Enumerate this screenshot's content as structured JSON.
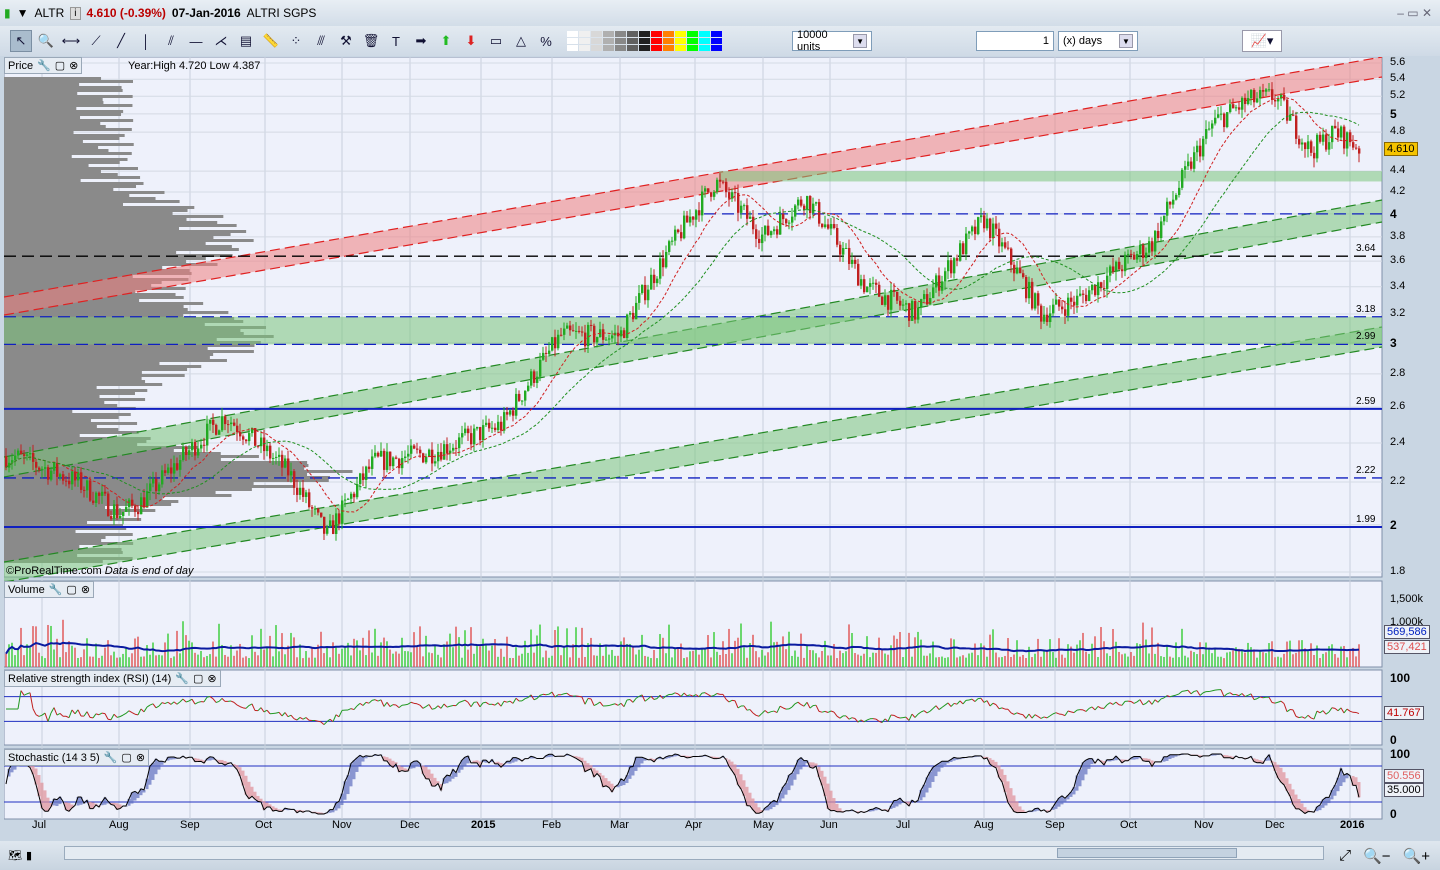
{
  "title": {
    "symbol": "ALTR",
    "price": "4.610 (-0.39%)",
    "date": "07-Jan-2016",
    "name": "ALTRI SGPS"
  },
  "toolbar": {
    "units": "10000 units",
    "period_value": "1",
    "period_unit": "(x) days",
    "icons": [
      "pointer-icon",
      "zoom-icon",
      "horizontal-line-icon",
      "segment-icon",
      "line-icon",
      "vertical-line-icon",
      "channel-icon",
      "hline-icon",
      "fan-icon",
      "indicator-icon",
      "ruler-icon",
      "points-icon",
      "parallel-icon",
      "tools-icon",
      "trash-icon",
      "text-icon",
      "arrow-right-icon",
      "arrow-up-icon",
      "arrow-down-icon",
      "rectangle-icon",
      "triangle-icon",
      "percent-icon"
    ],
    "colors": [
      "#ffffff",
      "#f0f0f0",
      "#d8d8d8",
      "#b0b0b0",
      "#888888",
      "#606060",
      "#202020",
      "#ff0000",
      "#ff8000",
      "#ffff00",
      "#00ff00",
      "#00ffff",
      "#0000ff"
    ]
  },
  "panels": {
    "price": {
      "label": "Price",
      "info": "Year:High 4.720 Low 4.387",
      "footer": "©ProRealTime.com",
      "footer_note": "Data is end of day",
      "last": "4.610",
      "yticks": [
        "5.6",
        "5.4",
        "5.2",
        "5",
        "4.8",
        "4.4",
        "4.2",
        "4",
        "3.8",
        "3.6",
        "3.4",
        "3.2",
        "3",
        "2.8",
        "2.6",
        "2.4",
        "2.2",
        "2",
        "1.8"
      ],
      "levels": [
        "3.64",
        "3.18",
        "2.99",
        "2.59",
        "2.22",
        "1.99"
      ]
    },
    "volume": {
      "label": "Volume",
      "yticks": [
        "1,500k",
        "1,000k"
      ],
      "ma": "569,586",
      "last": "537,421"
    },
    "rsi": {
      "label": "Relative strength index (RSI) (14)",
      "yticks": [
        "100",
        "0"
      ],
      "last": "41.767"
    },
    "stoch": {
      "label": "Stochastic (14 3 5)",
      "yticks": [
        "100",
        "0"
      ],
      "k": "50.556",
      "d": "35.000"
    }
  },
  "xaxis": [
    "Jul",
    "Aug",
    "Sep",
    "Oct",
    "Nov",
    "Dec",
    "2015",
    "Feb",
    "Mar",
    "Apr",
    "May",
    "Jun",
    "Jul",
    "Aug",
    "Sep",
    "Oct",
    "Nov",
    "Dec",
    "2016"
  ],
  "chart_data": {
    "type": "candlestick",
    "title": "ALTR",
    "scale": "log",
    "ylim": [
      1.8,
      5.6
    ],
    "x": [
      "2014-06-20",
      "2014-07-15",
      "2014-08-01",
      "2014-08-10",
      "2014-09-15",
      "2014-10-10",
      "2014-10-25",
      "2014-11-15",
      "2014-12-10",
      "2015-01-10",
      "2015-02-05",
      "2015-03-01",
      "2015-04-10",
      "2015-05-01",
      "2015-05-20",
      "2015-06-15",
      "2015-07-05",
      "2015-08-01",
      "2015-08-25",
      "2015-09-10",
      "2015-10-10",
      "2015-11-05",
      "2015-11-20",
      "2015-12-01",
      "2015-12-15",
      "2015-12-25",
      "2016-01-07"
    ],
    "close": [
      2.33,
      2.2,
      2.05,
      2.1,
      2.55,
      2.25,
      1.95,
      2.3,
      2.35,
      2.5,
      3.05,
      3.05,
      4.3,
      3.8,
      4.15,
      3.4,
      3.2,
      3.95,
      3.2,
      3.3,
      3.75,
      4.9,
      5.15,
      5.2,
      4.6,
      4.8,
      4.61
    ]
  }
}
